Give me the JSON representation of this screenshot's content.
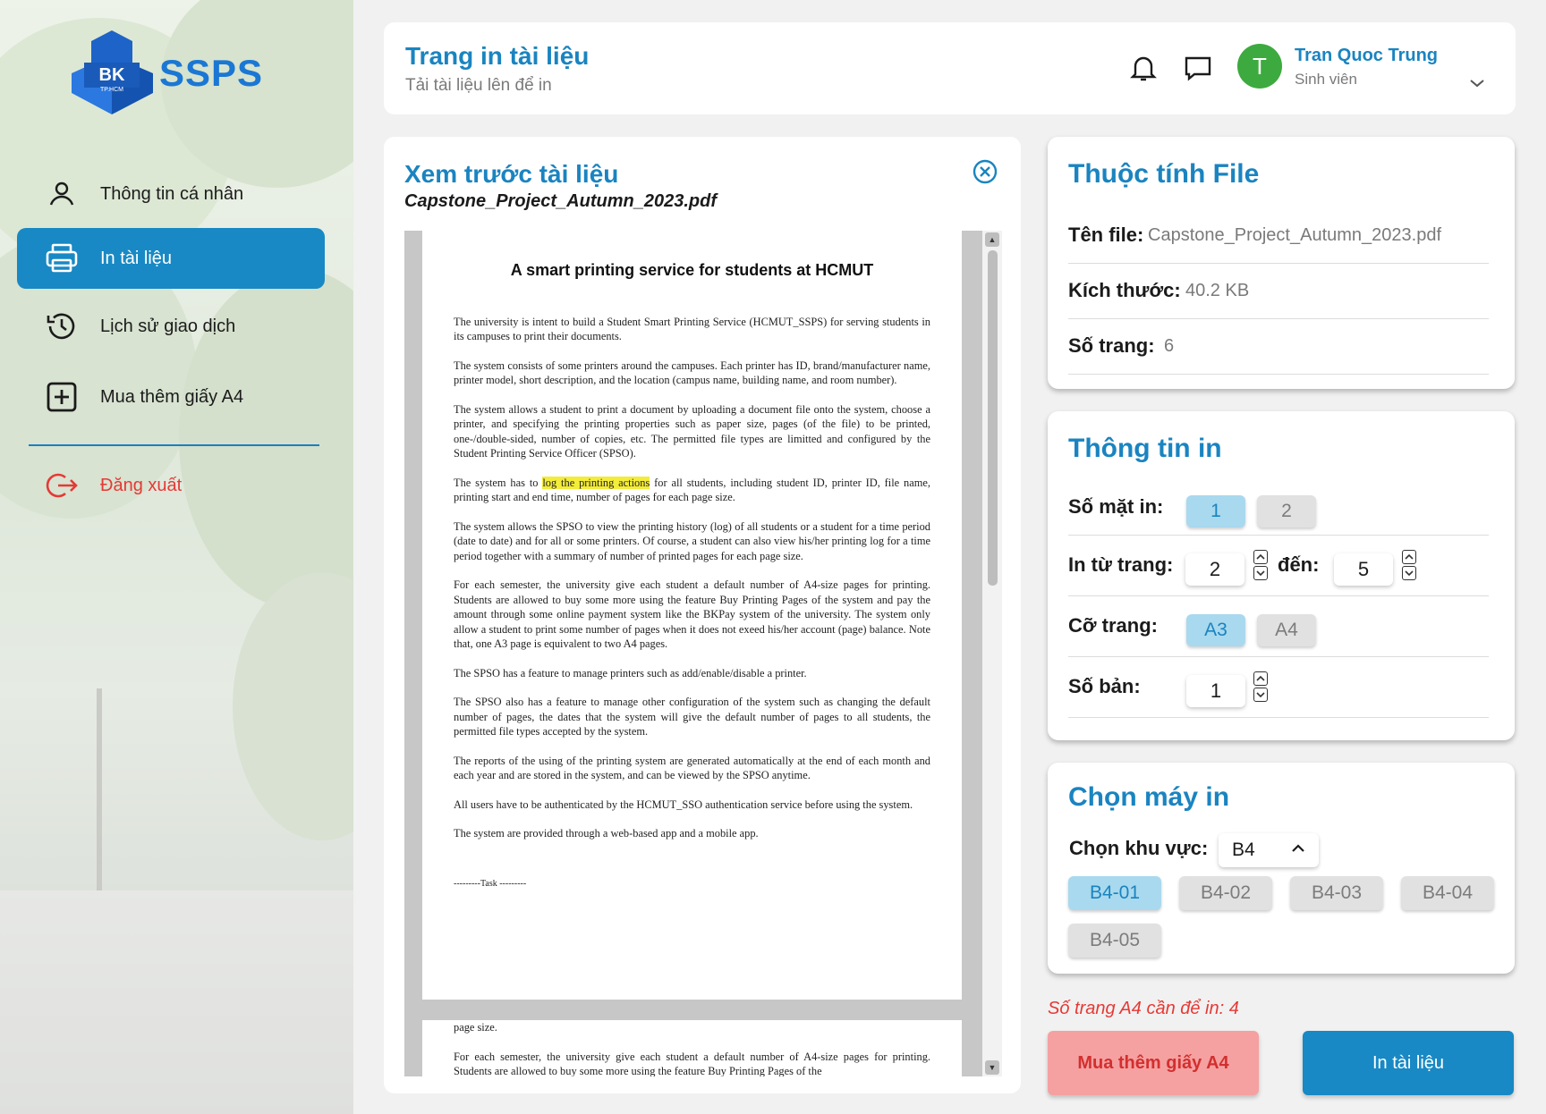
{
  "brand": {
    "name": "SSPS",
    "logo_mark": "BK",
    "logo_sub": "TP.HCM"
  },
  "sidebar": {
    "items": [
      {
        "label": "Thông tin cá nhân",
        "icon": "user-icon"
      },
      {
        "label": "In tài liệu",
        "icon": "printer-icon",
        "active": true
      },
      {
        "label": "Lịch sử giao dịch",
        "icon": "history-icon"
      },
      {
        "label": "Mua thêm giấy A4",
        "icon": "plus-square-icon"
      }
    ],
    "logout": {
      "label": "Đăng xuất",
      "icon": "logout-icon"
    }
  },
  "header": {
    "title": "Trang in tài liệu",
    "subtitle": "Tải tài liệu lên để in",
    "user": {
      "initial": "T",
      "name": "Tran Quoc Trung",
      "role": "Sinh viên"
    }
  },
  "preview": {
    "title": "Xem trước tài liệu",
    "file_name": "Capstone_Project_Autumn_2023.pdf",
    "doc": {
      "heading": "A smart printing service for students at HCMUT",
      "paragraphs": [
        "The university is intent to build a Student Smart Printing Service (HCMUT_SSPS) for serving students in its campuses to print their documents.",
        "The system consists of some printers around the campuses. Each printer has ID, brand/manufacturer name, printer model, short description, and the location (campus name, building name, and room number).",
        "The system allows a student to print a document by uploading a document file onto the system, choose a printer, and specifying the printing properties such as paper size, pages (of the file) to be printed, one-/double-sided, number of copies, etc. The permitted file types are limitted and configured by the Student Printing Service Officer (SPSO).",
        "The system allows the SPSO to view the printing history (log) of all students or a student for a time period (date to date) and for all or some printers. Of course, a student can also view his/her printing log for a time period together with a summary of number of printed pages for each page size.",
        "For each semester, the university give each student a default number of A4-size pages for printing. Students are allowed to buy some more using the feature Buy Printing Pages of the system and pay the amount through some online payment system like the BKPay system of the university. The system only allow a student to print some number of pages when it does not exeed his/her account (page) balance. Note that, one A3 page is equivalent to two A4 pages.",
        "The SPSO has a feature to manage printers such as add/enable/disable a printer.",
        "The SPSO also has a feature to manage other configuration of the system such as changing the default number of pages, the dates that the system will give the default number of pages to all students, the permitted file types accepted by the system.",
        "The reports of the using of the printing system are generated automatically at the end of each month and each year and are stored in the system, and can be viewed by the SPSO anytime.",
        "All users have to be authenticated by the HCMUT_SSO authentication service before using the system.",
        "The system are provided through a web-based app and a mobile app."
      ],
      "p5_before": "The system has to ",
      "p5_highlight": "log the printing actions",
      "p5_after": " for all students, including student ID, printer ID, file name, printing start and end time, number of pages for each page size.",
      "task_line": "---------Task ---------",
      "page2_line1": "page size.",
      "page2_para": "For each semester, the university give each student a default number of A4-size pages for printing. Students are allowed to buy some more using the feature Buy Printing Pages of the"
    }
  },
  "file_props": {
    "title": "Thuộc tính File",
    "name_label": "Tên file:",
    "name_value": "Capstone_Project_Autumn_2023.pdf",
    "size_label": "Kích thước:",
    "size_value": "40.2 KB",
    "pages_label": "Số trang:",
    "pages_value": "6"
  },
  "print_info": {
    "title": "Thông tin in",
    "sides_label": "Số mặt in:",
    "sides_options": [
      "1",
      "2"
    ],
    "sides_selected": "1",
    "range_label": "In từ trang:",
    "from_value": "2",
    "to_label": "đến:",
    "to_value": "5",
    "size_label": "Cỡ trang:",
    "size_options": [
      "A3",
      "A4"
    ],
    "size_selected": "A3",
    "copies_label": "Số bản:",
    "copies_value": "1"
  },
  "printer": {
    "title": "Chọn máy in",
    "region_label": "Chọn khu vực:",
    "region_value": "B4",
    "printers": [
      "B4-01",
      "B4-02",
      "B4-03",
      "B4-04",
      "B4-05"
    ],
    "selected": "B4-01"
  },
  "summary": {
    "needed_text": "Số trang A4 cần để in: 4"
  },
  "actions": {
    "buy_label": "Mua thêm giấy A4",
    "print_label": "In tài liệu"
  },
  "colors": {
    "accent": "#1889c4",
    "danger": "#e53935",
    "danger_bg": "#f5a1a1",
    "selected_bg": "#a9d9ee"
  }
}
